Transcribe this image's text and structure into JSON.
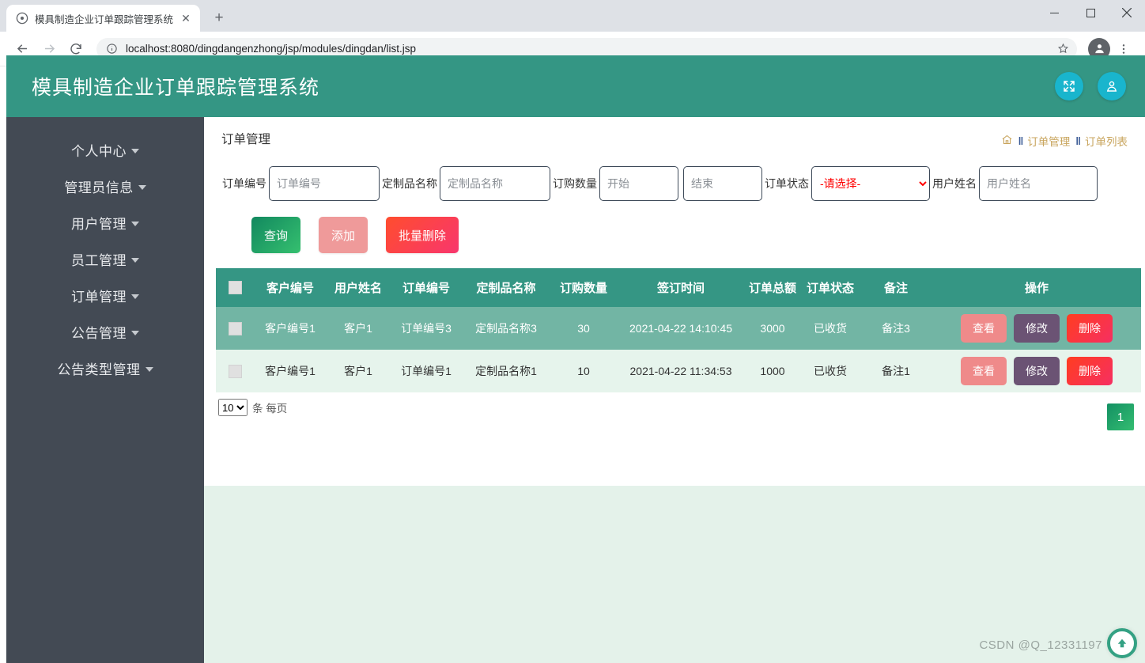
{
  "browser": {
    "tab_title": "模具制造企业订单跟踪管理系统",
    "tab_close_label": "✕",
    "new_tab_label": "+",
    "url": "localhost:8080/dingdangenzhong/jsp/modules/dingdan/list.jsp",
    "minimize_label": "―",
    "maximize_label": "□",
    "close_label": "✕"
  },
  "app": {
    "title": "模具制造企业订单跟踪管理系统"
  },
  "sidebar": {
    "items": [
      {
        "label": "个人中心"
      },
      {
        "label": "管理员信息"
      },
      {
        "label": "用户管理"
      },
      {
        "label": "员工管理"
      },
      {
        "label": "订单管理"
      },
      {
        "label": "公告管理"
      },
      {
        "label": "公告类型管理"
      }
    ]
  },
  "page": {
    "title": "订单管理",
    "breadcrumb": {
      "sep": "‖",
      "item1": "订单管理",
      "item2": "订单列表"
    }
  },
  "search": {
    "order_no_label": "订单编号",
    "order_no_placeholder": "订单编号",
    "order_no_value": "",
    "product_label": "定制品名称",
    "product_placeholder": "定制品名称",
    "product_value": "",
    "qty_label": "订购数量",
    "qty_start_placeholder": "开始",
    "qty_start_value": "",
    "qty_end_placeholder": "结束",
    "qty_end_value": "",
    "status_label": "订单状态",
    "status_selected": "-请选择-",
    "status_options": [
      "-请选择-"
    ],
    "user_label": "用户姓名",
    "user_placeholder": "用户姓名",
    "user_value": ""
  },
  "actions": {
    "query": "查询",
    "add": "添加",
    "batch_delete": "批量删除"
  },
  "table": {
    "headers": [
      "",
      "客户编号",
      "用户姓名",
      "订单编号",
      "定制品名称",
      "订购数量",
      "签订时间",
      "订单总额",
      "订单状态",
      "备注",
      "操作"
    ],
    "rows": [
      {
        "customer_no": "客户编号1",
        "user_name": "客户1",
        "order_no": "订单编号3",
        "product_name": "定制品名称3",
        "quantity": "30",
        "sign_time": "2021-04-22 14:10:45",
        "total": "3000",
        "status": "已收货",
        "remark": "备注3"
      },
      {
        "customer_no": "客户编号1",
        "user_name": "客户1",
        "order_no": "订单编号1",
        "product_name": "定制品名称1",
        "quantity": "10",
        "sign_time": "2021-04-22 11:34:53",
        "total": "1000",
        "status": "已收货",
        "remark": "备注1"
      }
    ],
    "row_actions": {
      "view": "查看",
      "edit": "修改",
      "delete": "删除"
    }
  },
  "pagination": {
    "page_size": "10",
    "page_size_options": [
      "10"
    ],
    "per_page_text": "条 每页",
    "current_page": "1"
  },
  "footer": {
    "watermark": "CSDN @Q_12331197"
  },
  "colors": {
    "brand_teal": "#349684",
    "sidebar": "#434a54",
    "header_icon": "#19b5cd",
    "table_header": "#359684",
    "row_hover": "#72b5a4",
    "row_alt": "#e6f4ec",
    "content_bg": "#e4f2ea",
    "btn_query": "#12885f",
    "btn_add": "#ef9a9a",
    "btn_delete": "#ff4d2e",
    "btn_edit": "#6b5374",
    "breadcrumb": "#c8a45c",
    "select_text": "#ff0000"
  }
}
